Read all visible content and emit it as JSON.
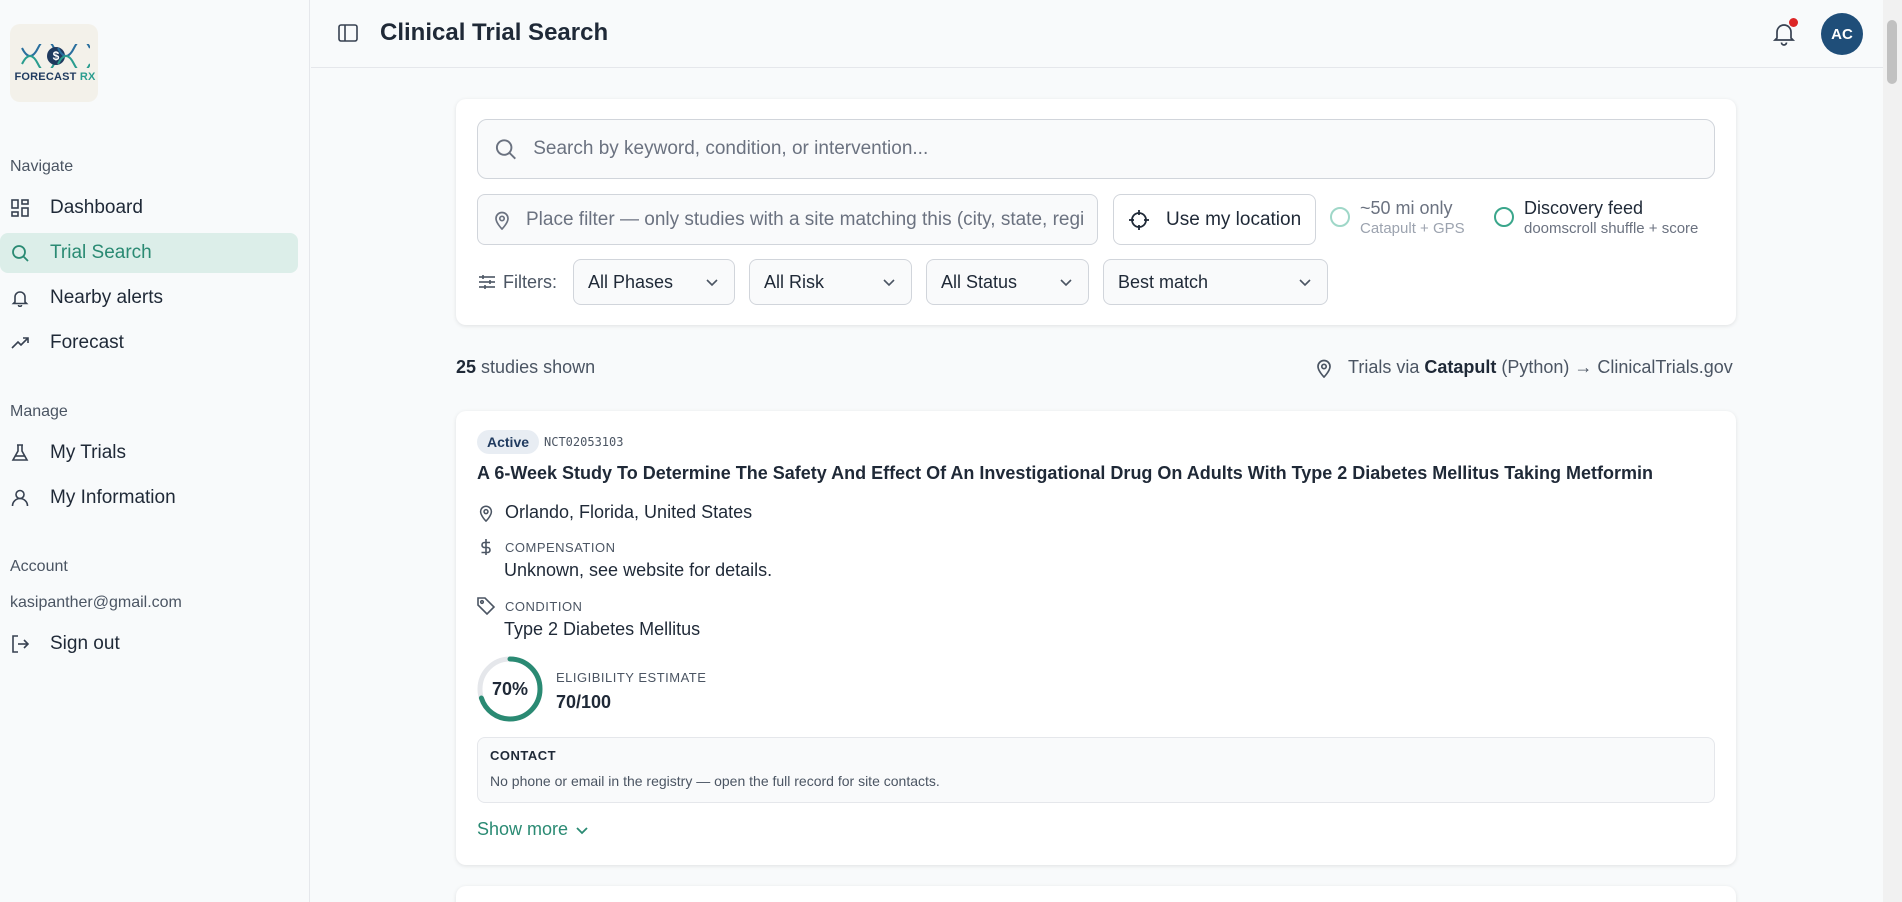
{
  "brand": {
    "logo_text": "FORECAST",
    "logo_rx": "RX"
  },
  "sidebar": {
    "navigate_heading": "Navigate",
    "navigate_items": [
      {
        "label": "Dashboard",
        "icon": "dashboard-icon"
      },
      {
        "label": "Trial Search",
        "icon": "search-icon",
        "active": true
      },
      {
        "label": "Nearby alerts",
        "icon": "bell-icon"
      },
      {
        "label": "Forecast",
        "icon": "trend-icon"
      }
    ],
    "manage_heading": "Manage",
    "manage_items": [
      {
        "label": "My Trials",
        "icon": "flask-icon"
      },
      {
        "label": "My Information",
        "icon": "user-icon"
      }
    ],
    "account_heading": "Account",
    "account_email": "kasipanther@gmail.com",
    "signout_label": "Sign out"
  },
  "header": {
    "title": "Clinical Trial Search",
    "avatar_initials": "AC"
  },
  "search": {
    "placeholder": "Search by keyword, condition, or intervention...",
    "place_placeholder": "Place filter — only studies with a site matching this (city, state, region)",
    "use_location_label": "Use my location",
    "radius_main": "~50 mi only",
    "radius_sub": "Catapult + GPS",
    "discovery_main": "Discovery feed",
    "discovery_sub": "doomscroll shuffle + score",
    "filters_label": "Filters:",
    "phase_value": "All Phases",
    "risk_value": "All Risk",
    "status_value": "All Status",
    "sort_value": "Best match"
  },
  "results": {
    "count": "25",
    "count_suffix": "studies shown",
    "source_prefix": "Trials via",
    "source_bold": "Catapult",
    "source_suffix": "(Python) → ClinicalTrials.gov"
  },
  "trial": {
    "status": "Active",
    "nct": "NCT02053103",
    "title": "A 6-Week Study To Determine The Safety And Effect Of An Investigational Drug On Adults With Type 2 Diabetes Mellitus Taking Metformin",
    "location": "Orlando, Florida, United States",
    "compensation_label": "COMPENSATION",
    "compensation_value": "Unknown, see website for details.",
    "condition_label": "CONDITION",
    "condition_value": "Type 2 Diabetes Mellitus",
    "eligibility_pct": "70%",
    "eligibility_fraction": 0.7,
    "eligibility_label": "ELIGIBILITY ESTIMATE",
    "eligibility_score": "70/100",
    "contact_label": "CONTACT",
    "contact_text": "No phone or email in the registry — open the full record for site contacts.",
    "show_more_label": "Show more"
  },
  "colors": {
    "accent": "#2a8a73",
    "avatar": "#1f4e79",
    "notification": "#dc2626"
  }
}
